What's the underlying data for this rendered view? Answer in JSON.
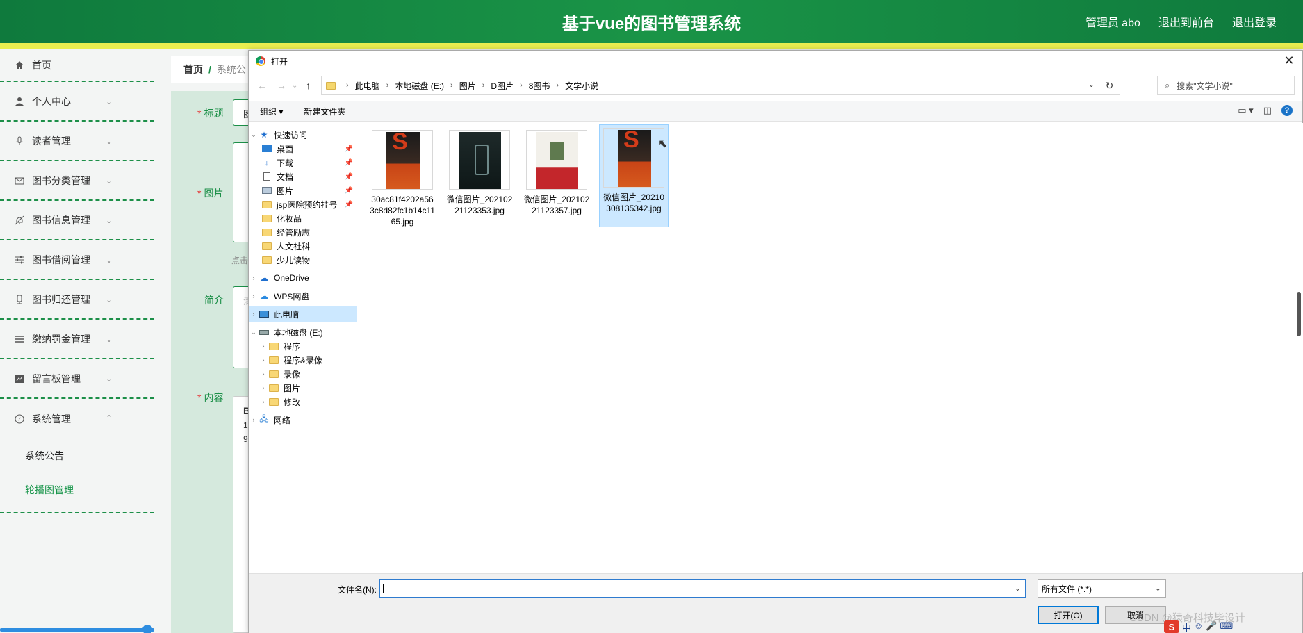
{
  "header": {
    "title": "基于vue的图书管理系统",
    "user": "管理员 abo",
    "to_front": "退出到前台",
    "logout": "退出登录"
  },
  "sidebar": {
    "items": [
      {
        "label": "首页",
        "icon": "home-icon"
      },
      {
        "label": "个人中心",
        "icon": "user-icon"
      },
      {
        "label": "读者管理",
        "icon": "microphone-icon"
      },
      {
        "label": "图书分类管理",
        "icon": "mail-icon"
      },
      {
        "label": "图书信息管理",
        "icon": "bell-off-icon"
      },
      {
        "label": "图书借阅管理",
        "icon": "sliders-icon"
      },
      {
        "label": "图书归还管理",
        "icon": "mic-icon"
      },
      {
        "label": "缴纳罚金管理",
        "icon": "menu-icon"
      },
      {
        "label": "留言板管理",
        "icon": "chart-icon"
      },
      {
        "label": "系统管理",
        "icon": "compass-icon"
      }
    ],
    "sub_items": [
      "系统公告",
      "轮播图管理"
    ]
  },
  "breadcrumb": {
    "home": "首页",
    "sep": "/",
    "current": "系统公"
  },
  "form": {
    "title_label": "标题",
    "image_label": "图片",
    "intro_label": "简介",
    "content_label": "内容",
    "behind_title_val": "图",
    "behind_hint": "点击",
    "behind_intro_val": "清",
    "behind_content_1": "B",
    "behind_content_2": "1",
    "behind_content_3": "9"
  },
  "dialog": {
    "title": "打开",
    "address": [
      "此电脑",
      "本地磁盘 (E:)",
      "图片",
      "D图片",
      "8图书",
      "文学小说"
    ],
    "search_placeholder": "搜索\"文学小说\"",
    "toolbar": {
      "organize": "组织 ▾",
      "new_folder": "新建文件夹"
    },
    "nav": {
      "quick_access": "快速访问",
      "quick_items": [
        "桌面",
        "下载",
        "文档",
        "图片",
        "jsp医院预约挂号",
        "化妆品",
        "经管励志",
        "人文社科",
        "少儿读物"
      ],
      "onedrive": "OneDrive",
      "wps": "WPS网盘",
      "this_pc": "此电脑",
      "disk": "本地磁盘 (E:)",
      "disk_items": [
        "程序",
        "程序&录像",
        "录像",
        "图片",
        "修改"
      ],
      "network": "网络"
    },
    "files": [
      {
        "name": "30ac81f4202a563c8d82fc1b14c1165.jpg",
        "cover": "red"
      },
      {
        "name": "微信图片_20210221123353.jpg",
        "cover": "dark"
      },
      {
        "name": "微信图片_20210221123357.jpg",
        "cover": "white"
      },
      {
        "name": "微信图片_20210308135342.jpg",
        "cover": "red"
      }
    ],
    "filename_label": "文件名(N):",
    "filename_value": "",
    "filetype": "所有文件 (*.*)",
    "open_btn": "打开(O)",
    "cancel_btn": "取消"
  },
  "watermark": "CSDN @猿奇科技毕设计",
  "tray": {
    "ime": "中",
    "logo": "S"
  },
  "colors": {
    "primary": "#1a9447",
    "accent_strip": "#e9ee50",
    "selection": "#cce8ff",
    "link_blue": "#0078d7"
  }
}
